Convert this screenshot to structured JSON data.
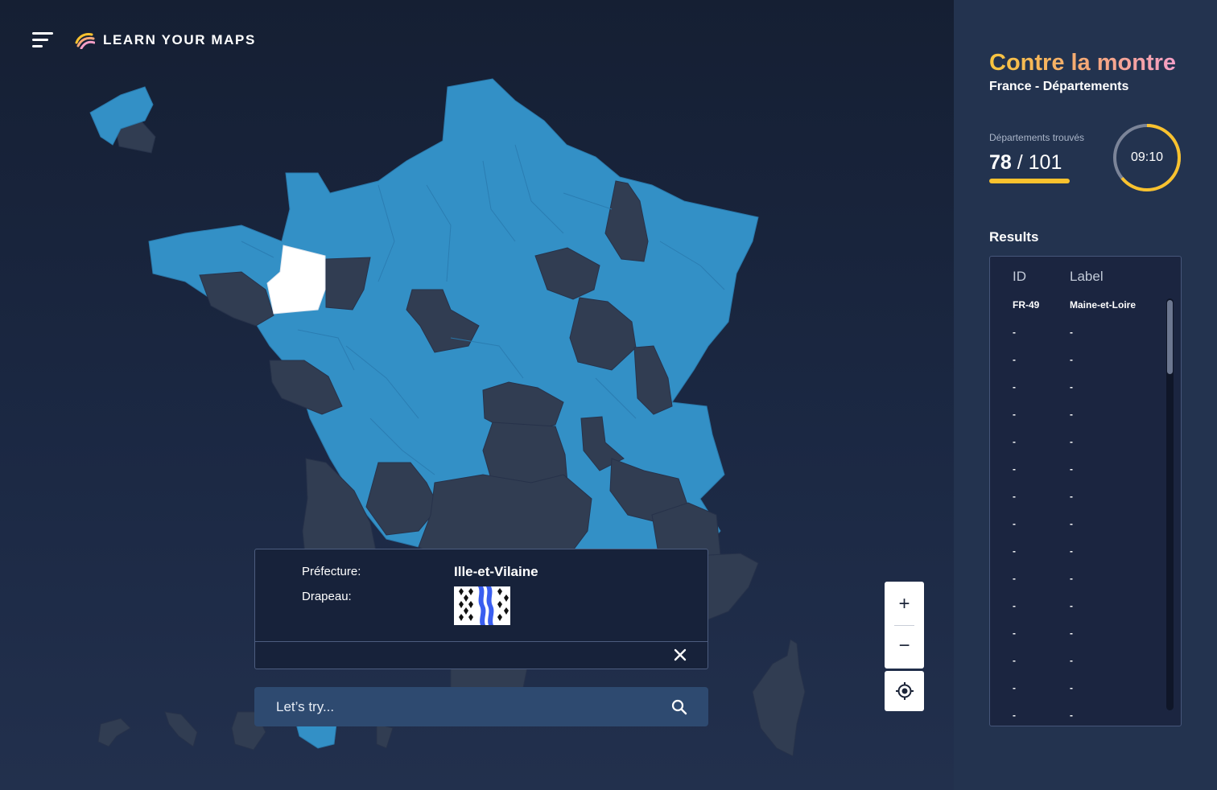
{
  "app": {
    "brand": "LEARN YOUR MAPS"
  },
  "colors": {
    "found": "#3390c6",
    "missing": "#313d52",
    "selected": "#ffffff",
    "accent_yellow": "#f9c22e",
    "panel_bg": "#23334f"
  },
  "info_panel": {
    "prefecture_label": "Préfecture:",
    "prefecture_value": "Ille-et-Vilaine",
    "flag_label": "Drapeau:"
  },
  "search": {
    "placeholder": "Let’s try..."
  },
  "zoom": {
    "in": "+",
    "out": "−"
  },
  "game": {
    "title": "Contre la montre",
    "subtitle": "France - Départements",
    "found_label": "Départements trouvés",
    "found": "78",
    "separator": " / ",
    "total": "101",
    "progress": 0.7723,
    "timer": "09:10",
    "timer_fraction": 0.64
  },
  "results": {
    "title": "Results",
    "columns": {
      "id": "ID",
      "label": "Label"
    },
    "rows": [
      {
        "id": "FR-49",
        "label": "Maine-et-Loire"
      },
      {
        "id": "-",
        "label": "-"
      },
      {
        "id": "-",
        "label": "-"
      },
      {
        "id": "-",
        "label": "-"
      },
      {
        "id": "-",
        "label": "-"
      },
      {
        "id": "-",
        "label": "-"
      },
      {
        "id": "-",
        "label": "-"
      },
      {
        "id": "-",
        "label": "-"
      },
      {
        "id": "-",
        "label": "-"
      },
      {
        "id": "-",
        "label": "-"
      },
      {
        "id": "-",
        "label": "-"
      },
      {
        "id": "-",
        "label": "-"
      },
      {
        "id": "-",
        "label": "-"
      },
      {
        "id": "-",
        "label": "-"
      },
      {
        "id": "-",
        "label": "-"
      },
      {
        "id": "-",
        "label": "-"
      }
    ]
  }
}
